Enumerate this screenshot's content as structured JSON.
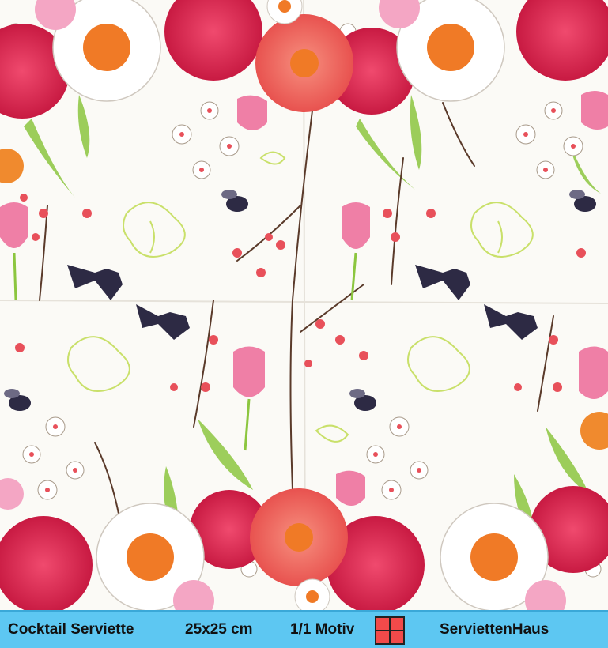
{
  "caption": {
    "product": "Cocktail Serviette",
    "size": "25x25 cm",
    "motif": "1/1 Motiv",
    "shop": "ServiettenHaus"
  },
  "colors": {
    "caption_bar": "#5dc7f2",
    "motif_icon_fill": "#f24a4a",
    "paper": "#fbfaf6",
    "peony": "#e0254f",
    "poppy": "#ee6a64",
    "daisy_center": "#f07a26",
    "tulip": "#ef7fa6",
    "daffodil_line": "#c9e06a",
    "leaf": "#8cc63f",
    "branch": "#5a3a2a",
    "insect": "#2d2a44"
  },
  "icons": [
    "square-grid-icon"
  ]
}
